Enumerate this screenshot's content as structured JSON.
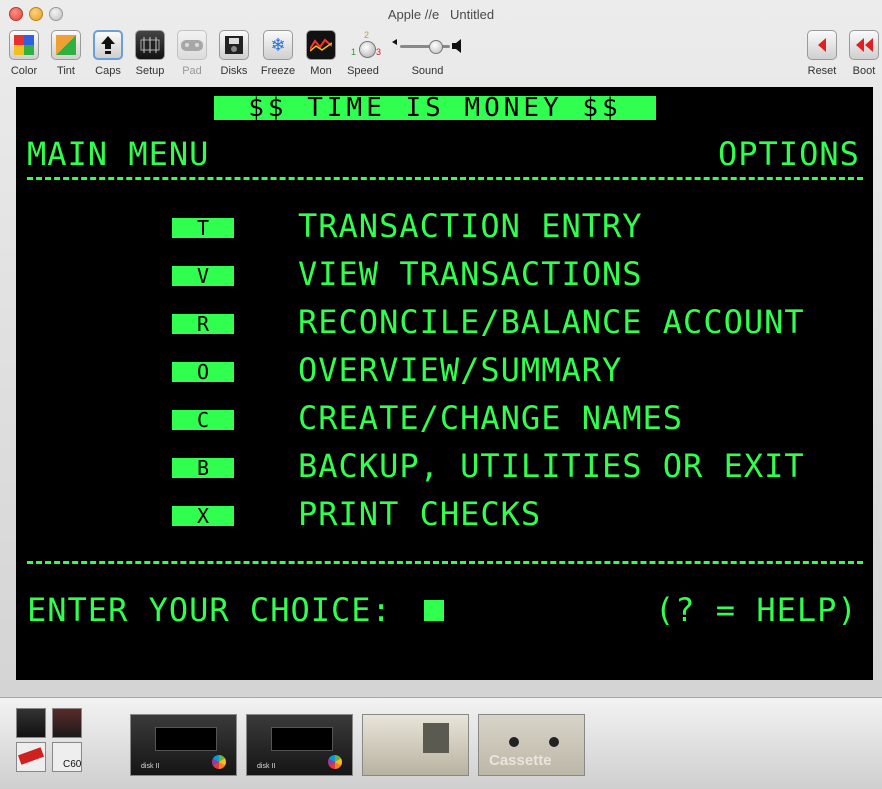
{
  "window": {
    "title": "Apple //e   Untitled"
  },
  "toolbar": {
    "color": "Color",
    "tint": "Tint",
    "caps": "Caps",
    "setup": "Setup",
    "pad": "Pad",
    "disks": "Disks",
    "freeze": "Freeze",
    "mon": "Mon",
    "speed": "Speed",
    "speed_marks": [
      "1",
      "2",
      "3"
    ],
    "sound": "Sound",
    "reset": "Reset",
    "boot": "Boot",
    "sound_level": 0.7
  },
  "screen": {
    "banner": "$$ TIME IS MONEY $$",
    "left_header": "MAIN MENU",
    "right_header": "OPTIONS",
    "menu": [
      {
        "key": "T",
        "label": "TRANSACTION ENTRY"
      },
      {
        "key": "V",
        "label": "VIEW TRANSACTIONS"
      },
      {
        "key": "R",
        "label": "RECONCILE/BALANCE ACCOUNT"
      },
      {
        "key": "O",
        "label": "OVERVIEW/SUMMARY"
      },
      {
        "key": "C",
        "label": "CREATE/CHANGE NAMES"
      },
      {
        "key": "B",
        "label": "BACKUP, UTILITIES OR EXIT"
      },
      {
        "key": "X",
        "label": "PRINT CHECKS"
      }
    ],
    "prompt": "ENTER YOUR CHOICE:",
    "help": "(? = HELP)"
  },
  "shelf": {
    "mini_c60": "C60",
    "drive1_label": "disk II",
    "drive2_label": "disk II",
    "cassette_label": "Cassette"
  },
  "colors": {
    "phosphor": "#30ff50",
    "screen_bg": "#000000",
    "reset_red": "#e02020"
  }
}
